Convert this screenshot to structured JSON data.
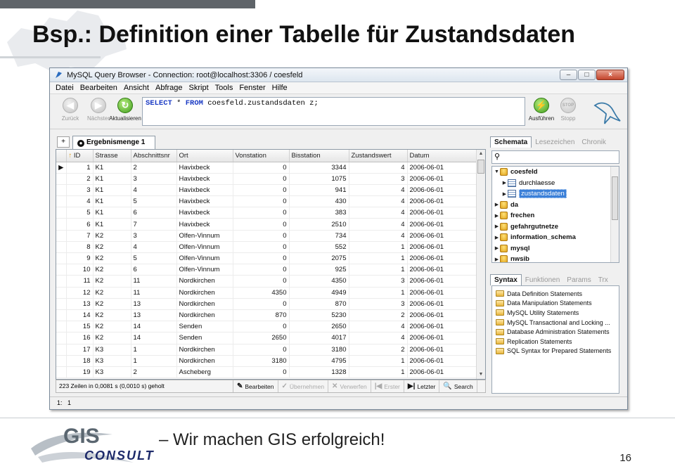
{
  "slide": {
    "title": "Bsp.: Definition einer Tabelle für Zustandsdaten",
    "slogan": "– Wir machen GIS erfolgreich!",
    "page_number": "16",
    "logo": {
      "line1": "GIS",
      "line2": "CONSULT"
    }
  },
  "window": {
    "title": "MySQL Query Browser - Connection: root@localhost:3306 / coesfeld",
    "controls": {
      "minimize": "–",
      "maximize": "□",
      "close": "×"
    }
  },
  "menu": [
    "Datei",
    "Bearbeiten",
    "Ansicht",
    "Abfrage",
    "Skript",
    "Tools",
    "Fenster",
    "Hilfe"
  ],
  "toolbar": {
    "back_label": "Zurück",
    "next_label": "Nächster",
    "refresh_label": "Aktualisieren",
    "execute_label": "Ausführen",
    "stop_label": "Stopp",
    "stop_icon_text": "STOP",
    "query": {
      "kw1": "SELECT",
      "star": " * ",
      "kw2": "FROM",
      "rest": " coesfeld.zustandsdaten z;"
    }
  },
  "result": {
    "new_tab_icon": "+",
    "tab_icon_text": "●",
    "tab_label": "Ergebnismenge 1",
    "sort_icon": "↑",
    "row_marker": "▶",
    "columns": [
      "ID",
      "Strasse",
      "Abschnittsnr",
      "Ort",
      "Vonstation",
      "Bisstation",
      "Zustandswert",
      "Datum"
    ],
    "rows": [
      [
        "1",
        "K1",
        "2",
        "Havixbeck",
        "0",
        "3344",
        "4",
        "2006-06-01"
      ],
      [
        "2",
        "K1",
        "3",
        "Havixbeck",
        "0",
        "1075",
        "3",
        "2006-06-01"
      ],
      [
        "3",
        "K1",
        "4",
        "Havixbeck",
        "0",
        "941",
        "4",
        "2006-06-01"
      ],
      [
        "4",
        "K1",
        "5",
        "Havixbeck",
        "0",
        "430",
        "4",
        "2006-06-01"
      ],
      [
        "5",
        "K1",
        "6",
        "Havixbeck",
        "0",
        "383",
        "4",
        "2006-06-01"
      ],
      [
        "6",
        "K1",
        "7",
        "Havixbeck",
        "0",
        "2510",
        "4",
        "2006-06-01"
      ],
      [
        "7",
        "K2",
        "3",
        "Olfen-Vinnum",
        "0",
        "734",
        "4",
        "2006-06-01"
      ],
      [
        "8",
        "K2",
        "4",
        "Olfen-Vinnum",
        "0",
        "552",
        "1",
        "2006-06-01"
      ],
      [
        "9",
        "K2",
        "5",
        "Olfen-Vinnum",
        "0",
        "2075",
        "1",
        "2006-06-01"
      ],
      [
        "10",
        "K2",
        "6",
        "Olfen-Vinnum",
        "0",
        "925",
        "1",
        "2006-06-01"
      ],
      [
        "11",
        "K2",
        "11",
        "Nordkirchen",
        "0",
        "4350",
        "3",
        "2006-06-01"
      ],
      [
        "12",
        "K2",
        "11",
        "Nordkirchen",
        "4350",
        "4949",
        "1",
        "2006-06-01"
      ],
      [
        "13",
        "K2",
        "13",
        "Nordkirchen",
        "0",
        "870",
        "3",
        "2006-06-01"
      ],
      [
        "14",
        "K2",
        "13",
        "Nordkirchen",
        "870",
        "5230",
        "2",
        "2006-06-01"
      ],
      [
        "15",
        "K2",
        "14",
        "Senden",
        "0",
        "2650",
        "4",
        "2006-06-01"
      ],
      [
        "16",
        "K2",
        "14",
        "Senden",
        "2650",
        "4017",
        "4",
        "2006-06-01"
      ],
      [
        "17",
        "K3",
        "1",
        "Nordkirchen",
        "0",
        "3180",
        "2",
        "2006-06-01"
      ],
      [
        "18",
        "K3",
        "1",
        "Nordkirchen",
        "3180",
        "4795",
        "1",
        "2006-06-01"
      ],
      [
        "19",
        "K3",
        "2",
        "Ascheberg",
        "0",
        "1328",
        "1",
        "2006-06-01"
      ]
    ],
    "status_text": "223 Zeilen in 0,0081 s (0,0010 s) geholt",
    "actions": [
      {
        "icon": "✎",
        "label": "Bearbeiten",
        "enabled": true
      },
      {
        "icon": "✓",
        "label": "Übernehmen",
        "enabled": false
      },
      {
        "icon": "✕",
        "label": "Verwerfen",
        "enabled": false
      },
      {
        "icon": "|◀",
        "label": "Erster",
        "enabled": false
      },
      {
        "icon": "▶|",
        "label": "Letzter",
        "enabled": true
      },
      {
        "icon": "🔍",
        "label": "Search",
        "enabled": true
      }
    ]
  },
  "schema_panel": {
    "tabs": [
      "Schemata",
      "Lesezeichen",
      "Chronik"
    ],
    "active_tab": "Schemata",
    "search_icon": "⚲",
    "tree": [
      {
        "name": "coesfeld",
        "type": "db",
        "expanded": true,
        "level": 0
      },
      {
        "name": "durchlaesse",
        "type": "table",
        "level": 1
      },
      {
        "name": "zustandsdaten",
        "type": "table",
        "level": 1,
        "selected": true
      },
      {
        "name": "da",
        "type": "db",
        "level": 0
      },
      {
        "name": "frechen",
        "type": "db",
        "level": 0
      },
      {
        "name": "gefahrgutnetze",
        "type": "db",
        "level": 0
      },
      {
        "name": "information_schema",
        "type": "db",
        "level": 0
      },
      {
        "name": "mysql",
        "type": "db",
        "level": 0
      },
      {
        "name": "nwsib",
        "type": "db",
        "level": 0
      }
    ]
  },
  "syntax_panel": {
    "tabs": [
      "Syntax",
      "Funktionen",
      "Params",
      "Trx"
    ],
    "active_tab": "Syntax",
    "items": [
      "Data Definition Statements",
      "Data Manipulation Statements",
      "MySQL Utility Statements",
      "MySQL Transactional and Locking ...",
      "Database Administration Statements",
      "Replication Statements",
      "SQL Syntax for Prepared Statements"
    ]
  },
  "bottom_status": {
    "line": "1:",
    "col": "1"
  }
}
